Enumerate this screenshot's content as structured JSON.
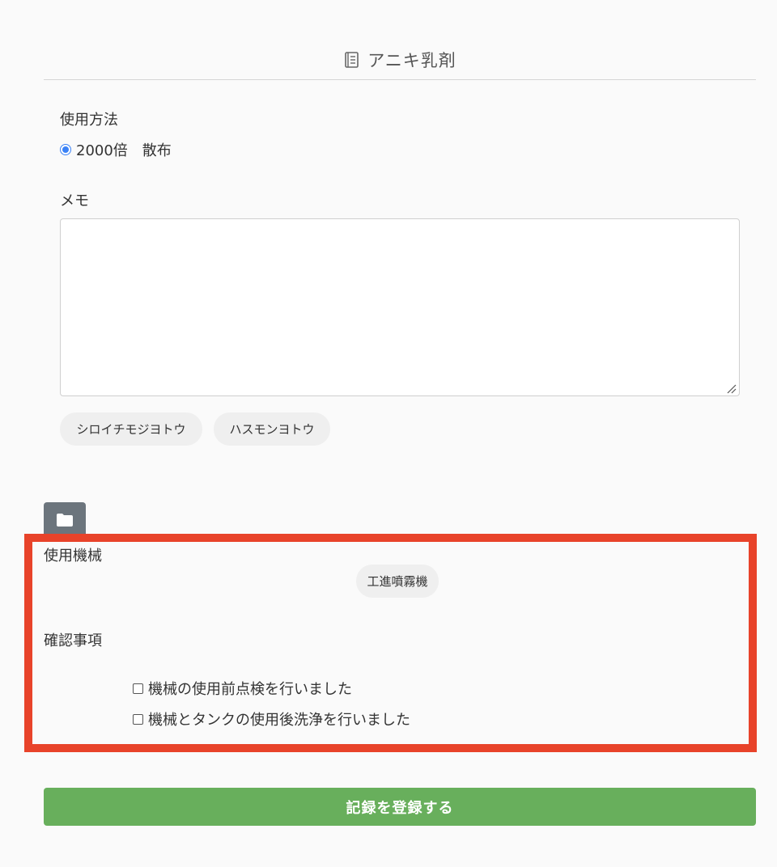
{
  "header": {
    "title": "アニキ乳剤",
    "icon": "book-icon"
  },
  "usage": {
    "label": "使用方法",
    "option_label": "2000倍　散布",
    "selected": true
  },
  "memo": {
    "label": "メモ",
    "value": "",
    "chips": [
      "シロイチモジヨトウ",
      "ハスモンヨトウ"
    ]
  },
  "folder": {
    "icon": "folder-icon"
  },
  "machine": {
    "label": "使用機械",
    "chip": "工進噴霧機"
  },
  "confirm": {
    "label": "確認事項",
    "items": [
      {
        "label": "機械の使用前点検を行いました",
        "checked": false
      },
      {
        "label": "機械とタンクの使用後洗浄を行いました",
        "checked": false
      }
    ]
  },
  "submit": {
    "label": "記録を登録する"
  },
  "colors": {
    "highlight": "#e8432a",
    "submit": "#68af5c",
    "radio": "#3b82f6",
    "folder_button": "#6c757d"
  }
}
